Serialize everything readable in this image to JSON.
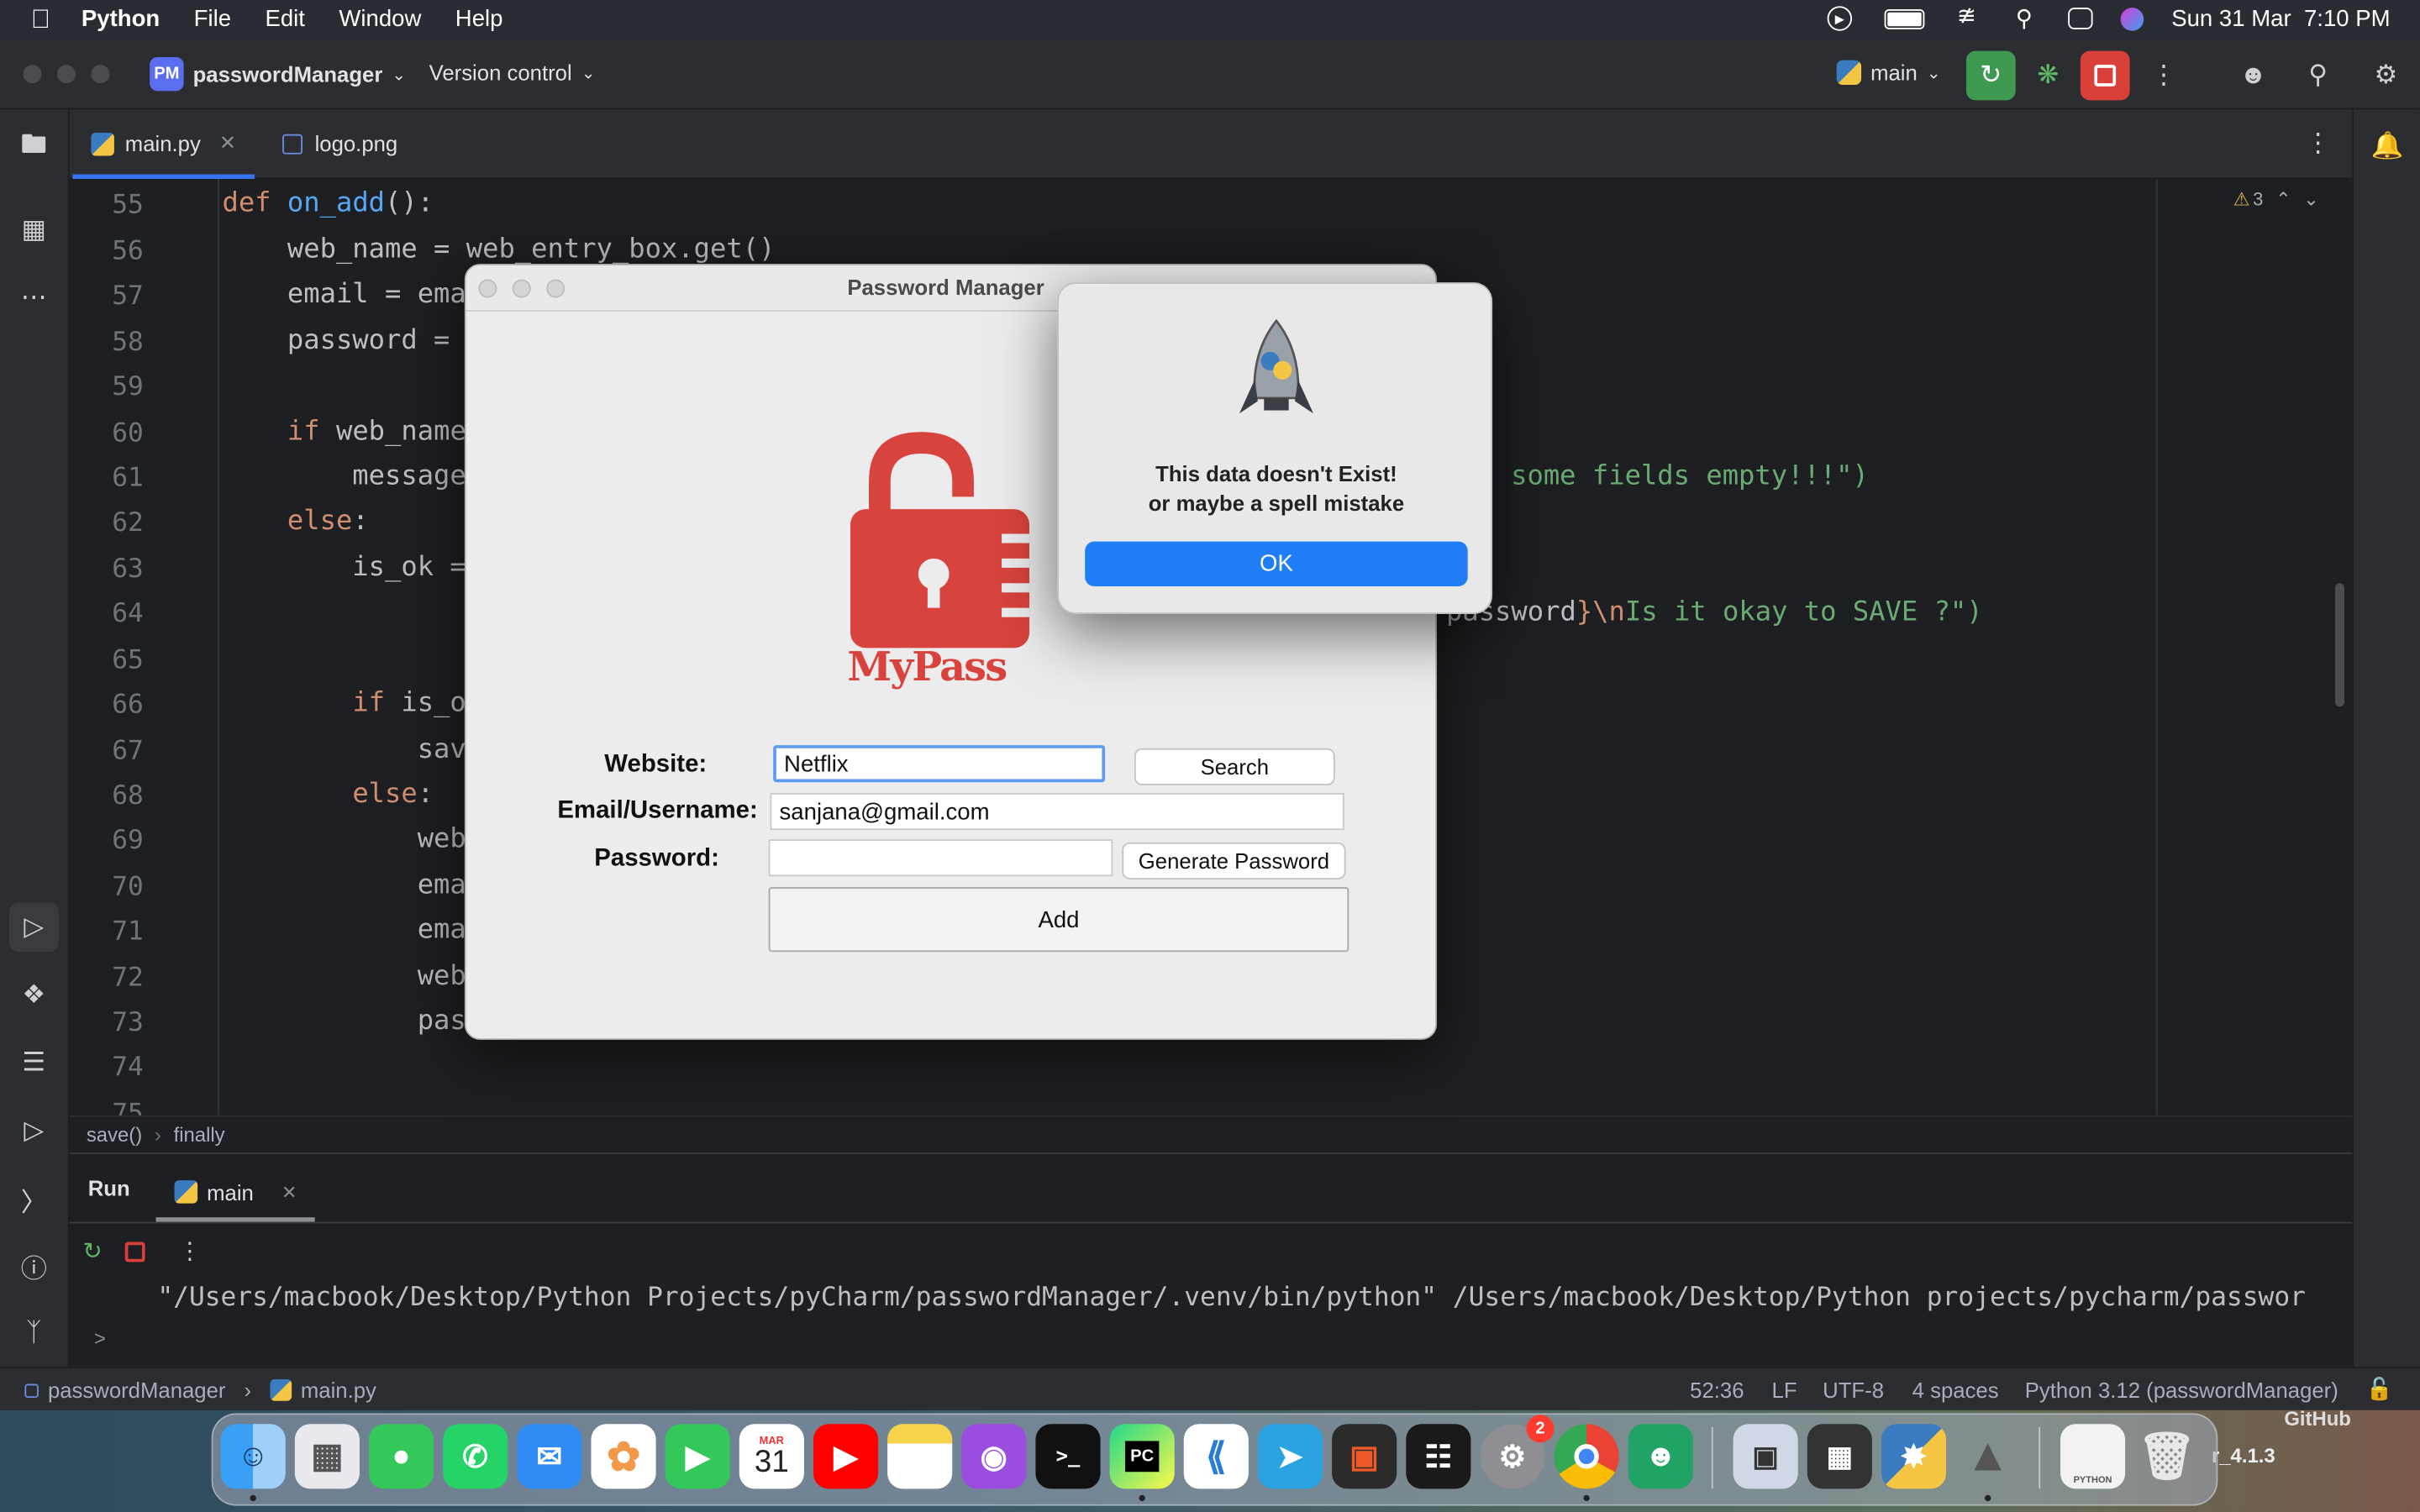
{
  "menubar": {
    "app_name": "Python",
    "items": [
      "File",
      "Edit",
      "Window",
      "Help"
    ],
    "clock": "Sun 31 Mar  7:10 PM"
  },
  "titlebar": {
    "project_badge": "PM",
    "project_name": "passwordManager",
    "vcs_label": "Version control",
    "branch": "main"
  },
  "tabs": [
    {
      "label": "main.py",
      "active": true
    },
    {
      "label": "logo.png",
      "active": false
    }
  ],
  "editor": {
    "warning_count": "3",
    "line_numbers": [
      "55",
      "56",
      "57",
      "58",
      "59",
      "60",
      "61",
      "62",
      "63",
      "64",
      "65",
      "66",
      "67",
      "68",
      "69",
      "70",
      "71",
      "72",
      "73",
      "74",
      "75"
    ],
    "code": {
      "l55": {
        "kw": "def ",
        "fn": "on_add",
        "rest": "():"
      },
      "l56": "    web_name = web_entry_box.get()",
      "l57": "    email = ema",
      "l58": "    password = ",
      "l60": {
        "indent": "    ",
        "kw": "if",
        "rest": " web_name"
      },
      "l61": "        message",
      "l61_tail": "some fields empty!!!\")",
      "l62": {
        "indent": "    ",
        "kw": "else",
        "rest": ":"
      },
      "l63": "        is_ok =",
      "l64_tail_a": "password",
      "l64_tail_b": "}",
      "l64_tail_c": "\\n",
      "l64_tail_d": "Is it okay to SAVE ?\")",
      "l66": {
        "indent": "        ",
        "kw": "if",
        "rest": " is_o"
      },
      "l67": "            sav",
      "l68": {
        "indent": "        ",
        "kw": "else",
        "rest": ":"
      },
      "l69": "            web",
      "l70": "            ema",
      "l71": "            ema",
      "l72": "            web",
      "l73": "            pas"
    }
  },
  "breadcrumb": [
    "save()",
    "finally"
  ],
  "run_panel": {
    "title": "Run",
    "tab_label": "main",
    "console_line": "\"/Users/macbook/Desktop/Python Projects/pyCharm/passwordManager/.venv/bin/python\" /Users/macbook/Desktop/Python projects/pycharm/passwor",
    "prompt": ">"
  },
  "status_bar": {
    "project": "passwordManager",
    "file": "main.py",
    "position": "52:36",
    "line_sep": "LF",
    "encoding": "UTF-8",
    "indent": "4 spaces",
    "interpreter": "Python 3.12 (passwordManager)"
  },
  "tk_window": {
    "title": "Password Manager",
    "logo_text": "MyPass",
    "website_label": "Website:",
    "website_value": "Netflix",
    "search_label": "Search",
    "email_label": "Email/Username:",
    "email_value": "sanjana@gmail.com",
    "password_label": "Password:",
    "password_value": "",
    "generate_label": "Generate Password",
    "add_label": "Add"
  },
  "alert": {
    "line1": "This data doesn't Exist!",
    "line2": "or maybe a spell mistake",
    "ok_label": "OK"
  },
  "dock": {
    "calendar_month": "MAR",
    "calendar_day": "31",
    "settings_badge": "2",
    "pycharm_text": "PC",
    "wallpaper_text_a": "GitHub",
    "wallpaper_text_b": "r_4.1.3",
    "python_doc_label": "PYTHON"
  },
  "colors": {
    "accent": "#3574f0",
    "run_green": "#3d9a50",
    "stop_red": "#d9403a",
    "logo_red": "#d9433d",
    "keyword": "#cf8e6d",
    "function": "#56a8f5",
    "string": "#6aab73"
  }
}
